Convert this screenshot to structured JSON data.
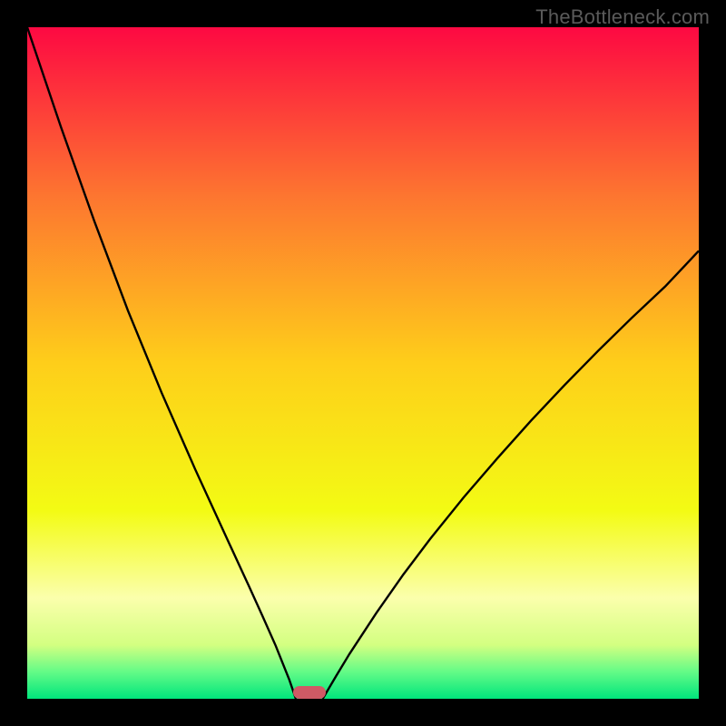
{
  "watermark": "TheBottleneck.com",
  "chart_data": {
    "type": "line",
    "title": "",
    "xlabel": "",
    "ylabel": "",
    "xlim": [
      0,
      100
    ],
    "ylim": [
      0,
      100
    ],
    "grid": false,
    "legend": false,
    "series": [
      {
        "name": "left-curve",
        "x": [
          0,
          5,
          10,
          15,
          20,
          25,
          30,
          33,
          35,
          37,
          39,
          40
        ],
        "y": [
          100,
          85.2,
          71.1,
          57.8,
          45.6,
          34.2,
          23.3,
          16.8,
          12.4,
          7.9,
          2.9,
          0
        ]
      },
      {
        "name": "right-curve",
        "x": [
          44,
          46,
          48,
          52,
          56,
          60,
          65,
          70,
          75,
          80,
          85,
          90,
          95,
          100
        ],
        "y": [
          0,
          3.4,
          6.7,
          12.8,
          18.5,
          23.8,
          30.0,
          35.8,
          41.4,
          46.7,
          51.8,
          56.7,
          61.4,
          66.7
        ]
      }
    ],
    "background_gradient": {
      "stops": [
        {
          "offset": 0.0,
          "color": "#fd0942"
        },
        {
          "offset": 0.25,
          "color": "#fd7530"
        },
        {
          "offset": 0.5,
          "color": "#fece1a"
        },
        {
          "offset": 0.72,
          "color": "#f3fb14"
        },
        {
          "offset": 0.85,
          "color": "#fbffac"
        },
        {
          "offset": 0.92,
          "color": "#d3ff81"
        },
        {
          "offset": 0.96,
          "color": "#63fb87"
        },
        {
          "offset": 1.0,
          "color": "#00e57c"
        }
      ]
    },
    "marker": {
      "x": 42,
      "y": 0,
      "color": "#cf5a65"
    }
  }
}
